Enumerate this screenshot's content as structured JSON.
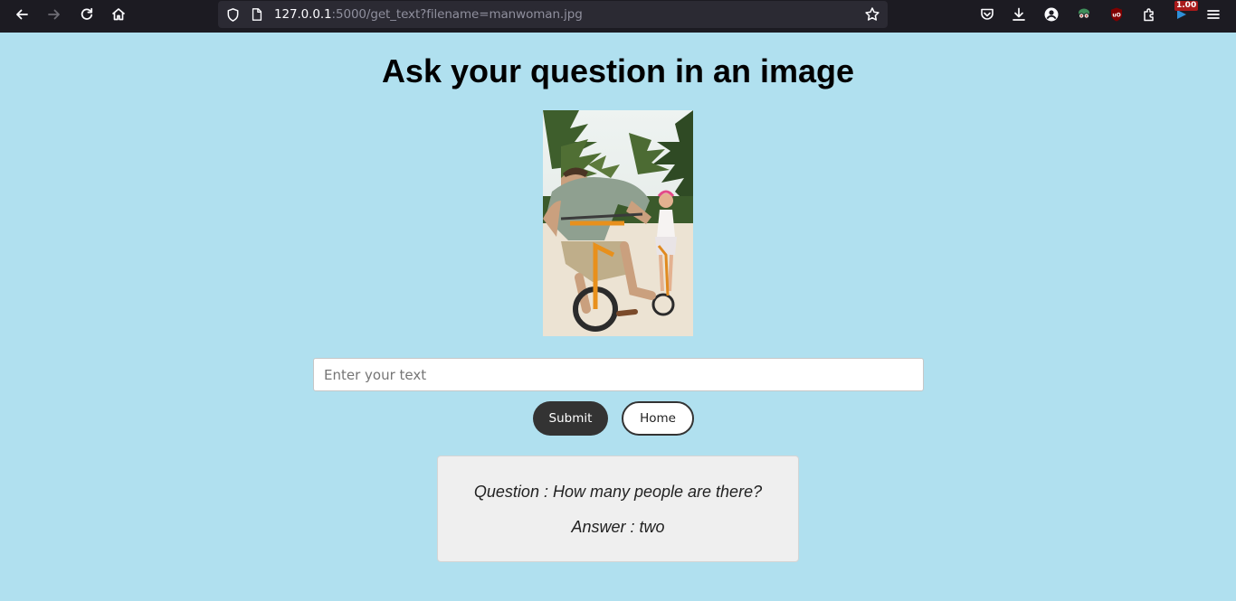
{
  "browser": {
    "url_host": "127.0.0.1",
    "url_rest": ":5000/get_text?filename=manwoman.jpg",
    "extension_badge": "1.00"
  },
  "page": {
    "title": "Ask your question in an image",
    "image_alt": "manwoman.jpg",
    "input_placeholder": "Enter your text",
    "input_value": "",
    "submit_label": "Submit",
    "home_label": "Home",
    "question_text": "Question : How many people are there?",
    "answer_text": "Answer : two"
  },
  "colors": {
    "page_background": "#b0e0ef",
    "submit_button": "#333333",
    "answer_box": "#efefef"
  },
  "icons": [
    "back-icon",
    "forward-icon",
    "reload-icon",
    "home-icon",
    "shield-icon",
    "page-icon",
    "star-icon",
    "pocket-icon",
    "download-icon",
    "account-icon",
    "extension-spy-icon",
    "ublock-icon",
    "puzzle-icon",
    "flag-extension-icon",
    "menu-icon"
  ]
}
